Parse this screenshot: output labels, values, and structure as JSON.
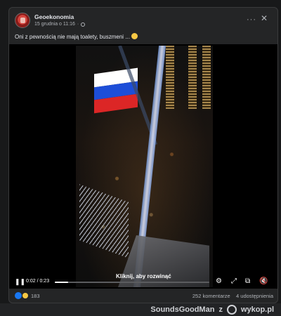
{
  "post": {
    "author": "Geoekonomia",
    "date": "15 grudnia o 11:16",
    "caption": "Oni z pewnością nie mają toalety, buszmeni ...",
    "more_icon": "more-icon",
    "close_icon": "close-icon"
  },
  "video": {
    "overlay_text": "Kliknij, aby rozwinąć",
    "time": "0:02 / 0:23",
    "progress": 0.087,
    "flag_colors": [
      "#ffffff",
      "#1d4ed8",
      "#dc2626"
    ]
  },
  "footer": {
    "reaction_count": "183",
    "comments": "252 komentarze",
    "shares": "4 udostępnienia"
  },
  "page_footer": {
    "user": "SoundsGoodMan",
    "connector": "z",
    "site": "wykop.pl"
  }
}
